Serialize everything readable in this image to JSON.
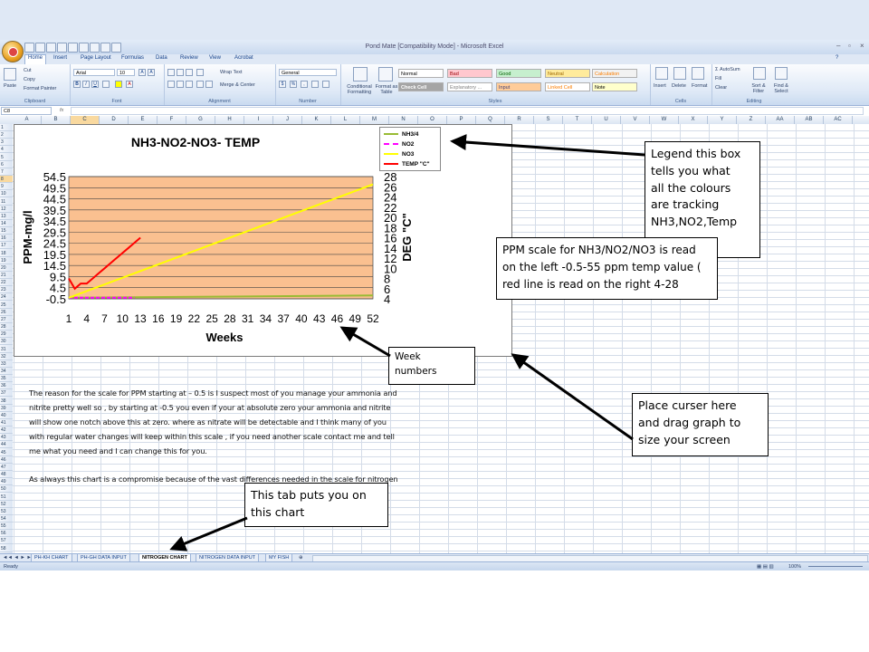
{
  "window": {
    "title": "Pond Mate  [Compatibility Mode] - Microsoft Excel",
    "controls": [
      "–",
      "▫",
      "×"
    ]
  },
  "ribbon": {
    "tabs": [
      "Home",
      "Insert",
      "Page Layout",
      "Formulas",
      "Data",
      "Review",
      "View",
      "Acrobat"
    ],
    "key_tips": [
      "H",
      "N",
      "P",
      "M",
      "A",
      "R",
      "W",
      "B"
    ],
    "clipboard": {
      "paste": "Paste",
      "cut": "Cut",
      "copy": "Copy",
      "format_painter": "Format Painter",
      "label": "Clipboard"
    },
    "font": {
      "name": "Arial",
      "size": "10",
      "label": "Font"
    },
    "alignment": {
      "wrap": "Wrap Text",
      "merge": "Merge & Center",
      "label": "Alignment"
    },
    "number": {
      "format": "General",
      "label": "Number"
    },
    "styles": {
      "conditional": "Conditional Formatting",
      "format_table": "Format as Table",
      "cells": [
        {
          "name": "Normal",
          "bg": "#ffffff",
          "fg": "#000000"
        },
        {
          "name": "Bad",
          "bg": "#ffc7ce",
          "fg": "#9c0006"
        },
        {
          "name": "Good",
          "bg": "#c6efce",
          "fg": "#006100"
        },
        {
          "name": "Neutral",
          "bg": "#ffeb9c",
          "fg": "#9c6500"
        },
        {
          "name": "Calculation",
          "bg": "#f2f2f2",
          "fg": "#fa7d00"
        },
        {
          "name": "Check Cell",
          "bg": "#a5a5a5",
          "fg": "#ffffff"
        },
        {
          "name": "Explanatory ...",
          "bg": "#ffffff",
          "fg": "#7f7f7f"
        },
        {
          "name": "Input",
          "bg": "#ffcc99",
          "fg": "#3f3f76"
        },
        {
          "name": "Linked Cell",
          "bg": "#ffffff",
          "fg": "#fa7d00"
        },
        {
          "name": "Note",
          "bg": "#ffffcc",
          "fg": "#000000"
        }
      ],
      "label": "Styles"
    },
    "cells": {
      "insert": "Insert",
      "delete": "Delete",
      "format": "Format",
      "label": "Cells"
    },
    "editing": {
      "autosum": "AutoSum",
      "fill": "Fill",
      "clear": "Clear",
      "sort": "Sort & Filter",
      "find": "Find & Select",
      "label": "Editing"
    }
  },
  "formula_bar": {
    "name_box": "C8",
    "fx": "fx",
    "content": ""
  },
  "columns": [
    "A",
    "B",
    "C",
    "D",
    "E",
    "F",
    "G",
    "H",
    "I",
    "J",
    "K",
    "L",
    "M",
    "N",
    "O",
    "P",
    "Q",
    "R",
    "S",
    "T",
    "U",
    "V",
    "W",
    "X",
    "Y",
    "Z",
    "AA",
    "AB",
    "AC"
  ],
  "rows_visible": 58,
  "sheets": [
    "PH-KH CHART",
    "PH-GH DATA INPUT",
    "NITROGEN  CHART",
    "NITROGEN DATA INPUT",
    "MY FISH"
  ],
  "active_sheet_index": 2,
  "status": {
    "ready": "Ready",
    "zoom": "100%"
  },
  "chart_data": {
    "type": "line",
    "title": "NH3-NO2-NO3-  TEMP",
    "xlabel": "Weeks",
    "ylabel": "PPM-mg/l",
    "y2label": "DEG \"C\"",
    "x_ticks": [
      "1",
      "4",
      "7",
      "10",
      "13",
      "16",
      "19",
      "22",
      "25",
      "28",
      "31",
      "34",
      "37",
      "40",
      "43",
      "46",
      "49",
      "52"
    ],
    "y_ticks": [
      "-0.5",
      "4.5",
      "9.5",
      "14.5",
      "19.5",
      "24.5",
      "29.5",
      "34.5",
      "39.5",
      "44.5",
      "49.5",
      "54.5"
    ],
    "y2_ticks": [
      "4",
      "6",
      "8",
      "10",
      "12",
      "14",
      "16",
      "18",
      "20",
      "22",
      "24",
      "26",
      "28"
    ],
    "ylim": [
      -0.5,
      54.5
    ],
    "y2lim": [
      4,
      28
    ],
    "xlim": [
      1,
      52
    ],
    "plot_bg": "#fac090",
    "series": [
      {
        "name": "NH3/4",
        "color": "#99bb33",
        "dash": false,
        "axis": "left",
        "x": [
          1,
          52
        ],
        "y": [
          0,
          1
        ]
      },
      {
        "name": "NO2",
        "color": "#ff00ff",
        "dash": true,
        "axis": "left",
        "x": [
          1,
          12
        ],
        "y": [
          0,
          0
        ]
      },
      {
        "name": "NO3",
        "color": "#ffff00",
        "dash": false,
        "axis": "left",
        "x": [
          1,
          52
        ],
        "y": [
          0,
          51
        ]
      },
      {
        "name": "TEMP \"C\"",
        "color": "#ff0000",
        "dash": false,
        "axis": "right",
        "x": [
          1,
          2,
          3,
          4,
          5,
          6,
          7,
          8,
          9,
          10,
          11,
          12,
          13
        ],
        "y": [
          8,
          6,
          7,
          7,
          8,
          9,
          10,
          11,
          12,
          13,
          14,
          15,
          16
        ]
      }
    ]
  },
  "body_text": [
    "The reason  for  the scale for PPM  starting  at – 0.5 is I suspect most of you manage   your ammonia and",
    "nitrite  pretty well so , by starting  at -0.5 you even if your at absolute  zero your ammonia and nitrite",
    "will show   one notch above this at zero.  where as nitrate will be detectable  and I think many of you",
    "with regular water changes will keep within this  scale , if you need another scale  contact me and tell",
    "me what  you need and I can change this for you.",
    "",
    "As always this  chart is a compromise  because of the vast differences needed in the scale for nitrogen"
  ],
  "callouts": {
    "legend": [
      "Legend this box",
      "tells you what",
      "all the colours",
      "are tracking",
      "NH3,NO2,Temp"
    ],
    "ppm": [
      "PPM scale for NH3/NO2/NO3 is read",
      "on the left -0.5-55 ppm  temp value (",
      "red line is read on the right 4-28"
    ],
    "weeks": [
      "Week",
      "numbers"
    ],
    "resize": [
      "Place curser here",
      "and drag graph  to",
      "size  your screen"
    ],
    "tab": [
      "This tab puts you on",
      "this chart"
    ]
  }
}
